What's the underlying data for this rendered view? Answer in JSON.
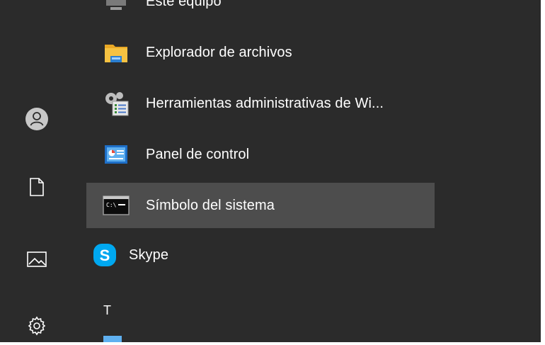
{
  "rail": {
    "items": [
      {
        "name": "user-account",
        "icon": "user-icon"
      },
      {
        "name": "documents",
        "icon": "document-icon"
      },
      {
        "name": "pictures",
        "icon": "pictures-icon"
      },
      {
        "name": "settings",
        "icon": "gear-icon"
      }
    ]
  },
  "apps": {
    "partial_top": "Este equipo",
    "items": [
      {
        "label": "Explorador de archivos",
        "icon": "folder-icon"
      },
      {
        "label": "Herramientas administrativas de Wi...",
        "icon": "admin-tools-icon"
      },
      {
        "label": "Panel de control",
        "icon": "control-panel-icon"
      },
      {
        "label": "Símbolo del sistema",
        "icon": "command-prompt-icon",
        "selected": true
      },
      {
        "label": "Skype",
        "icon": "skype-icon"
      }
    ],
    "group_letter_t": "T"
  },
  "colors": {
    "background": "#2b2b2b",
    "selected": "#4d4d4d",
    "text": "#ffffff",
    "skype": "#00a8f0",
    "folder": "#f5c242"
  }
}
